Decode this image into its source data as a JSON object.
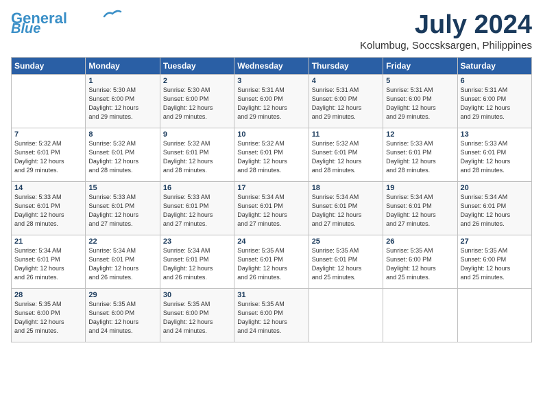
{
  "logo": {
    "line1": "General",
    "line2": "Blue"
  },
  "title": "July 2024",
  "location": "Kolumbug, Soccsksargen, Philippines",
  "weekdays": [
    "Sunday",
    "Monday",
    "Tuesday",
    "Wednesday",
    "Thursday",
    "Friday",
    "Saturday"
  ],
  "weeks": [
    [
      {
        "day": "",
        "info": ""
      },
      {
        "day": "1",
        "info": "Sunrise: 5:30 AM\nSunset: 6:00 PM\nDaylight: 12 hours\nand 29 minutes."
      },
      {
        "day": "2",
        "info": "Sunrise: 5:30 AM\nSunset: 6:00 PM\nDaylight: 12 hours\nand 29 minutes."
      },
      {
        "day": "3",
        "info": "Sunrise: 5:31 AM\nSunset: 6:00 PM\nDaylight: 12 hours\nand 29 minutes."
      },
      {
        "day": "4",
        "info": "Sunrise: 5:31 AM\nSunset: 6:00 PM\nDaylight: 12 hours\nand 29 minutes."
      },
      {
        "day": "5",
        "info": "Sunrise: 5:31 AM\nSunset: 6:00 PM\nDaylight: 12 hours\nand 29 minutes."
      },
      {
        "day": "6",
        "info": "Sunrise: 5:31 AM\nSunset: 6:00 PM\nDaylight: 12 hours\nand 29 minutes."
      }
    ],
    [
      {
        "day": "7",
        "info": "Sunrise: 5:32 AM\nSunset: 6:01 PM\nDaylight: 12 hours\nand 29 minutes."
      },
      {
        "day": "8",
        "info": "Sunrise: 5:32 AM\nSunset: 6:01 PM\nDaylight: 12 hours\nand 28 minutes."
      },
      {
        "day": "9",
        "info": "Sunrise: 5:32 AM\nSunset: 6:01 PM\nDaylight: 12 hours\nand 28 minutes."
      },
      {
        "day": "10",
        "info": "Sunrise: 5:32 AM\nSunset: 6:01 PM\nDaylight: 12 hours\nand 28 minutes."
      },
      {
        "day": "11",
        "info": "Sunrise: 5:32 AM\nSunset: 6:01 PM\nDaylight: 12 hours\nand 28 minutes."
      },
      {
        "day": "12",
        "info": "Sunrise: 5:33 AM\nSunset: 6:01 PM\nDaylight: 12 hours\nand 28 minutes."
      },
      {
        "day": "13",
        "info": "Sunrise: 5:33 AM\nSunset: 6:01 PM\nDaylight: 12 hours\nand 28 minutes."
      }
    ],
    [
      {
        "day": "14",
        "info": "Sunrise: 5:33 AM\nSunset: 6:01 PM\nDaylight: 12 hours\nand 28 minutes."
      },
      {
        "day": "15",
        "info": "Sunrise: 5:33 AM\nSunset: 6:01 PM\nDaylight: 12 hours\nand 27 minutes."
      },
      {
        "day": "16",
        "info": "Sunrise: 5:33 AM\nSunset: 6:01 PM\nDaylight: 12 hours\nand 27 minutes."
      },
      {
        "day": "17",
        "info": "Sunrise: 5:34 AM\nSunset: 6:01 PM\nDaylight: 12 hours\nand 27 minutes."
      },
      {
        "day": "18",
        "info": "Sunrise: 5:34 AM\nSunset: 6:01 PM\nDaylight: 12 hours\nand 27 minutes."
      },
      {
        "day": "19",
        "info": "Sunrise: 5:34 AM\nSunset: 6:01 PM\nDaylight: 12 hours\nand 27 minutes."
      },
      {
        "day": "20",
        "info": "Sunrise: 5:34 AM\nSunset: 6:01 PM\nDaylight: 12 hours\nand 26 minutes."
      }
    ],
    [
      {
        "day": "21",
        "info": "Sunrise: 5:34 AM\nSunset: 6:01 PM\nDaylight: 12 hours\nand 26 minutes."
      },
      {
        "day": "22",
        "info": "Sunrise: 5:34 AM\nSunset: 6:01 PM\nDaylight: 12 hours\nand 26 minutes."
      },
      {
        "day": "23",
        "info": "Sunrise: 5:34 AM\nSunset: 6:01 PM\nDaylight: 12 hours\nand 26 minutes."
      },
      {
        "day": "24",
        "info": "Sunrise: 5:35 AM\nSunset: 6:01 PM\nDaylight: 12 hours\nand 26 minutes."
      },
      {
        "day": "25",
        "info": "Sunrise: 5:35 AM\nSunset: 6:01 PM\nDaylight: 12 hours\nand 25 minutes."
      },
      {
        "day": "26",
        "info": "Sunrise: 5:35 AM\nSunset: 6:00 PM\nDaylight: 12 hours\nand 25 minutes."
      },
      {
        "day": "27",
        "info": "Sunrise: 5:35 AM\nSunset: 6:00 PM\nDaylight: 12 hours\nand 25 minutes."
      }
    ],
    [
      {
        "day": "28",
        "info": "Sunrise: 5:35 AM\nSunset: 6:00 PM\nDaylight: 12 hours\nand 25 minutes."
      },
      {
        "day": "29",
        "info": "Sunrise: 5:35 AM\nSunset: 6:00 PM\nDaylight: 12 hours\nand 24 minutes."
      },
      {
        "day": "30",
        "info": "Sunrise: 5:35 AM\nSunset: 6:00 PM\nDaylight: 12 hours\nand 24 minutes."
      },
      {
        "day": "31",
        "info": "Sunrise: 5:35 AM\nSunset: 6:00 PM\nDaylight: 12 hours\nand 24 minutes."
      },
      {
        "day": "",
        "info": ""
      },
      {
        "day": "",
        "info": ""
      },
      {
        "day": "",
        "info": ""
      }
    ]
  ]
}
